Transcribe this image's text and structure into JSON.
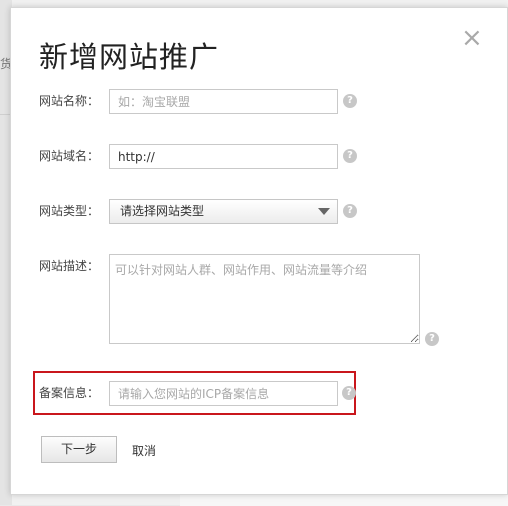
{
  "background": {
    "edge_text": "货"
  },
  "dialog": {
    "title": "新增网站推广",
    "close_symbol": "×"
  },
  "form": {
    "site_name": {
      "label": "网站名称：",
      "placeholder": "如：淘宝联盟"
    },
    "site_domain": {
      "label": "网站域名：",
      "value": "http://"
    },
    "site_type": {
      "label": "网站类型：",
      "selected": "请选择网站类型"
    },
    "site_desc": {
      "label": "网站描述：",
      "placeholder": "可以针对网站人群、网站作用、网站流量等介绍"
    },
    "icp": {
      "label": "备案信息：",
      "placeholder": "请输入您网站的ICP备案信息"
    },
    "help_symbol": "?"
  },
  "actions": {
    "next_label": "下一步",
    "cancel_label": "取消"
  },
  "colors": {
    "highlight_border": "#c9161c",
    "help_icon": "#c7c7c7"
  }
}
